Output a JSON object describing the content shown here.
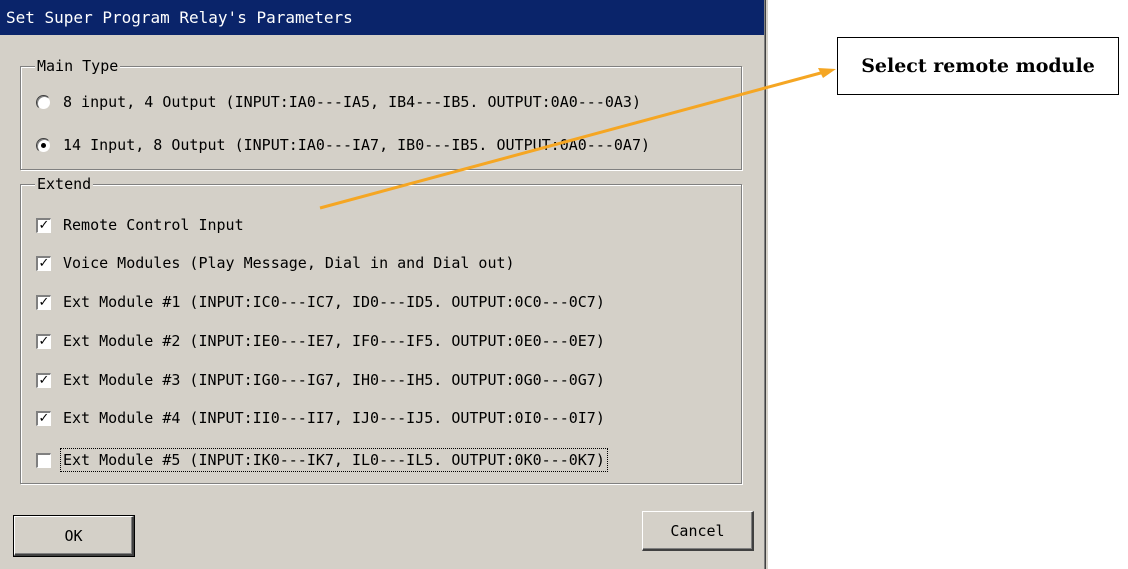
{
  "window": {
    "title": "Set Super Program Relay's Parameters"
  },
  "main_type": {
    "label": "Main Type",
    "options": [
      {
        "label": "8  input, 4 Output (INPUT:IA0---IA5, IB4---IB5. OUTPUT:0A0---0A3)",
        "selected": false
      },
      {
        "label": "14 Input, 8 Output (INPUT:IA0---IA7, IB0---IB5. OUTPUT:0A0---0A7)",
        "selected": true
      }
    ]
  },
  "extend": {
    "label": "Extend",
    "items": [
      {
        "label": "Remote Control Input",
        "checked": true
      },
      {
        "label": "Voice Modules (Play Message, Dial in and Dial out)",
        "checked": true
      },
      {
        "label": "Ext Module #1 (INPUT:IC0---IC7, ID0---ID5. OUTPUT:0C0---0C7)",
        "checked": true
      },
      {
        "label": "Ext Module #2 (INPUT:IE0---IE7, IF0---IF5. OUTPUT:0E0---0E7)",
        "checked": true
      },
      {
        "label": "Ext Module #3 (INPUT:IG0---IG7, IH0---IH5. OUTPUT:0G0---0G7)",
        "checked": true
      },
      {
        "label": "Ext Module #4 (INPUT:II0---II7, IJ0---IJ5. OUTPUT:0I0---0I7)",
        "checked": true
      },
      {
        "label": "Ext Module #5 (INPUT:IK0---IK7, IL0---IL5. OUTPUT:0K0---0K7)",
        "checked": false
      }
    ]
  },
  "buttons": {
    "ok": "OK",
    "cancel": "Cancel"
  },
  "callout": {
    "text": "Select remote module",
    "arrow_color": "#f5a623"
  },
  "colors": {
    "titlebar": "#0a246a",
    "dialog": "#d4d0c8"
  }
}
